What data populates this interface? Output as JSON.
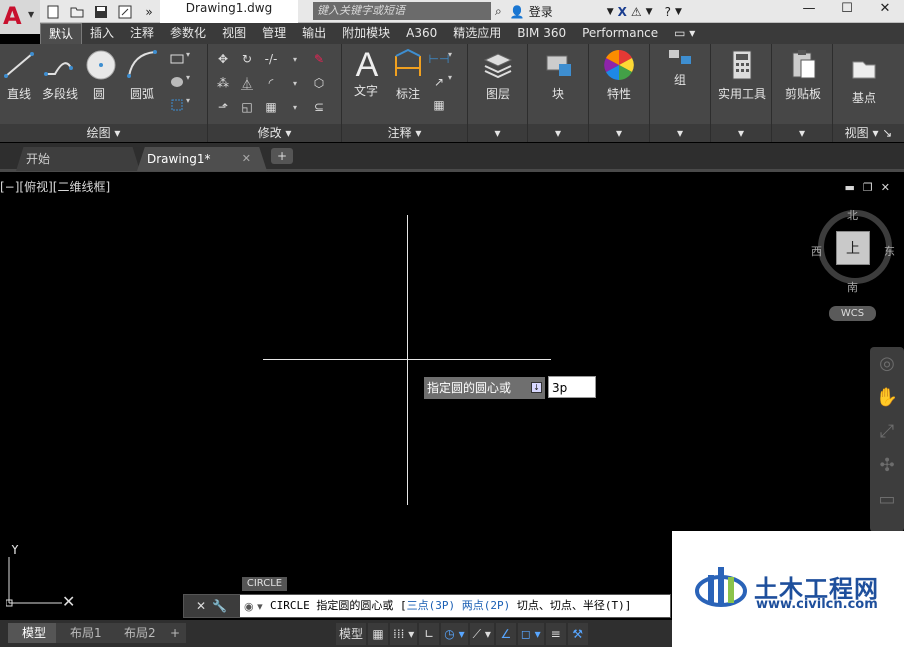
{
  "titlebar": {
    "doc_title": "Drawing1.dwg",
    "search_placeholder": "键入关键字或短语",
    "login_label": "登录",
    "minimize": "—",
    "maximize": "☐",
    "close": "✕"
  },
  "ribbon_tabs": [
    "默认",
    "插入",
    "注释",
    "参数化",
    "视图",
    "管理",
    "输出",
    "附加模块",
    "A360",
    "精选应用",
    "BIM 360",
    "Performance"
  ],
  "ribbon": {
    "draw": {
      "title": "绘图",
      "line": "直线",
      "polyline": "多段线",
      "circle": "圆",
      "arc": "圆弧"
    },
    "modify": {
      "title": "修改"
    },
    "annotation": {
      "title": "注释",
      "text": "文字",
      "dimension": "标注"
    },
    "layers": {
      "label": "图层"
    },
    "block": {
      "label": "块"
    },
    "properties": {
      "label": "特性"
    },
    "groups": {
      "label": "组"
    },
    "utilities": {
      "label": "实用工具"
    },
    "clipboard": {
      "label": "剪贴板"
    },
    "base": {
      "label": "基点"
    },
    "view": {
      "title": "视图"
    }
  },
  "file_tabs": {
    "start": "开始",
    "drawing": "Drawing1*",
    "close": "✕",
    "new": "+"
  },
  "viewport": {
    "label": "[−][俯视][二维线框]",
    "controls": [
      "▬",
      "❐",
      "✕"
    ],
    "viewcube": {
      "north": "北",
      "south": "南",
      "east": "东",
      "west": "西",
      "face": "上",
      "wcs": "WCS"
    },
    "prompt": "指定圆的圆心或",
    "input_value": "3p"
  },
  "command": {
    "tag": "CIRCLE",
    "prefix": "CIRCLE 指定圆的圆心或 [",
    "opt1": "三点(3P)",
    "opt2": "两点(2P)",
    "rest": "切点、切点、半径(T)]"
  },
  "layout_tabs": [
    "模型",
    "布局1",
    "布局2"
  ],
  "status": {
    "model": "模型"
  },
  "watermark": {
    "title": "土木工程网",
    "url": "www.civilcn.com"
  }
}
